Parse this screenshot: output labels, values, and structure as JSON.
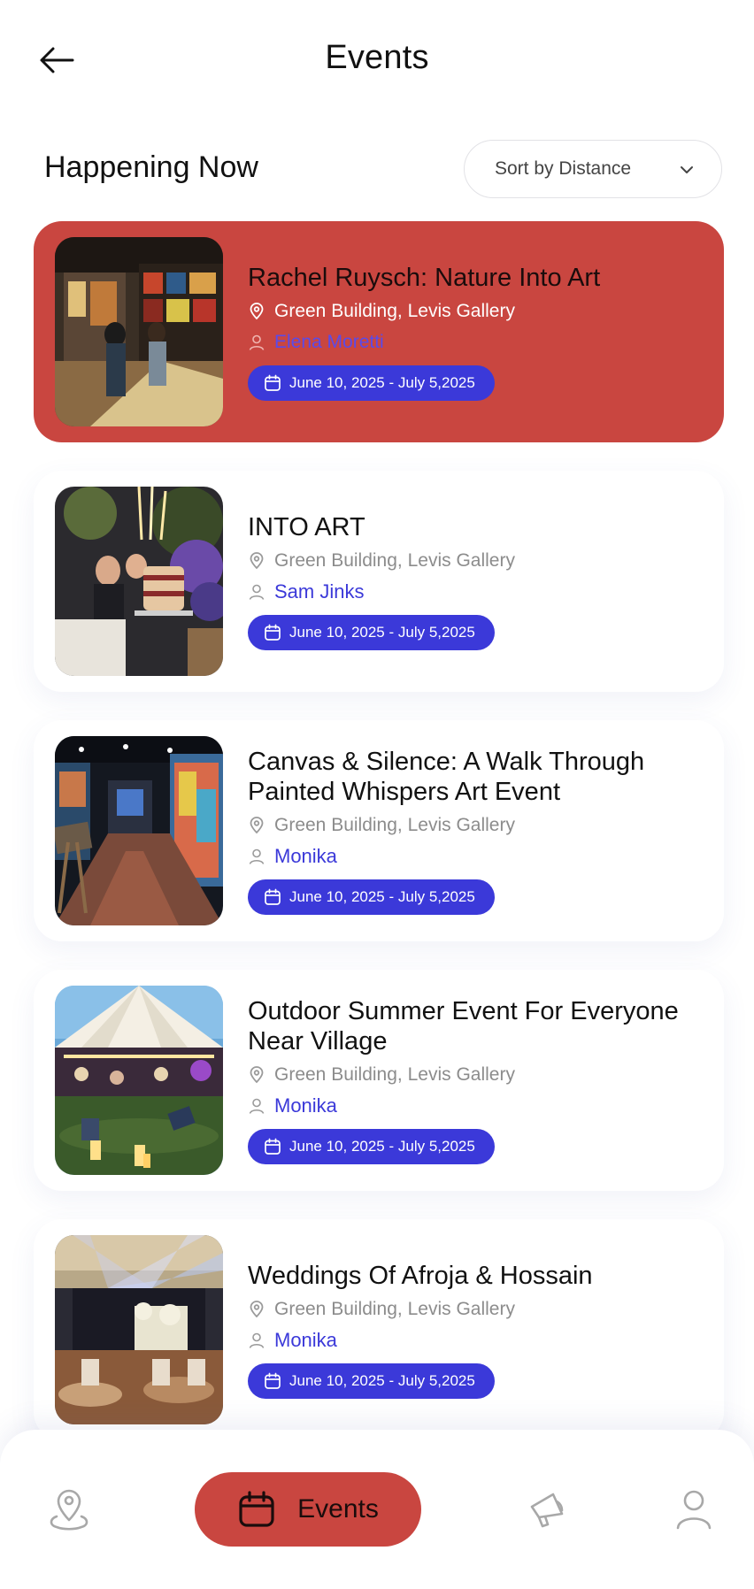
{
  "header": {
    "title": "Events"
  },
  "section": {
    "title": "Happening Now",
    "sort_label": "Sort by Distance"
  },
  "events": [
    {
      "title": "Rachel Ruysch: Nature Into Art",
      "location": "Green Building, Levis Gallery",
      "host": "Elena Moretti",
      "dates": "June 10, 2025 - July 5,2025",
      "active": true
    },
    {
      "title": "INTO ART",
      "location": "Green Building, Levis Gallery",
      "host": "Sam Jinks",
      "dates": "June 10, 2025 - July 5,2025",
      "active": false
    },
    {
      "title": "Canvas & Silence: A Walk Through Painted Whispers Art Event",
      "location": "Green Building, Levis Gallery",
      "host": "Monika",
      "dates": "June 10, 2025 - July 5,2025",
      "active": false
    },
    {
      "title": "Outdoor Summer Event For Everyone Near Village",
      "location": "Green Building, Levis Gallery",
      "host": "Monika",
      "dates": "June 10, 2025 - July 5,2025",
      "active": false
    },
    {
      "title": "Weddings Of Afroja & Hossain",
      "location": "Green Building, Levis Gallery",
      "host": "Monika",
      "dates": "June 10, 2025 - July 5,2025",
      "active": false
    }
  ],
  "nav": {
    "items": [
      {
        "icon": "map-pin-person-icon"
      },
      {
        "icon": "calendar-icon",
        "label": "Events",
        "active": true
      },
      {
        "icon": "megaphone-icon"
      },
      {
        "icon": "user-icon"
      }
    ]
  },
  "colors": {
    "accent_red": "#c94640",
    "accent_blue": "#3b39d9",
    "text_muted": "#8c8c8c"
  }
}
